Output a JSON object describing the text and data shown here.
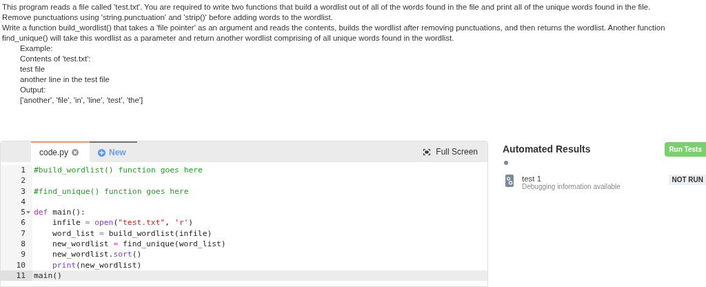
{
  "description": {
    "paragraphs": [
      "This program reads a file called 'test.txt'. You are required to write two functions that build a wordlist out of all of the words found in the file and print all of the unique words found in the file.",
      "Remove punctuations using 'string.punctuation' and 'strip()' before adding words to the wordlist.",
      "Write a function build_wordlist() that takes a 'file pointer' as an argument and reads the contents, builds the wordlist after removing punctuations, and then returns the wordlist. Another function",
      "find_unique() will take this wordlist as a parameter and return another wordlist comprising of all unique words found in the wordlist."
    ],
    "example": [
      "Example:",
      "Contents of 'test.txt':",
      "test file",
      "another line in the test file",
      "Output:",
      "['another', 'file', 'in', 'line', 'test', 'the']"
    ]
  },
  "editor": {
    "tabs": [
      {
        "label": "code.py",
        "kind": "file",
        "selected": true
      },
      {
        "label": "New",
        "kind": "new",
        "selected": false
      }
    ],
    "full_screen": "Full Screen",
    "lines": [
      {
        "number": "1",
        "fold": false,
        "active": false,
        "tokens": [
          {
            "kind": "comment",
            "t": "#build_wordlist() function goes here"
          }
        ]
      },
      {
        "number": "2",
        "fold": false,
        "active": false
      },
      {
        "number": "3",
        "fold": false,
        "active": false,
        "tokens": [
          {
            "kind": "comment",
            "t": "#find_unique() function goes here"
          }
        ]
      },
      {
        "number": "4",
        "fold": false,
        "active": false
      },
      {
        "number": "5",
        "fold": true,
        "active": false,
        "tokens": [
          {
            "kind": "keyword",
            "t": "def"
          },
          {
            "kind": "plain",
            "t": " main():"
          }
        ],
        "children": [
          {
            "number": "6",
            "fold": false,
            "active": false,
            "tokens": [
              {
                "kind": "plain",
                "t": "infile"
              },
              {
                "kind": "op",
                "t": " = "
              },
              {
                "kind": "builtin",
                "t": "open"
              },
              {
                "kind": "plain",
                "t": "("
              },
              {
                "kind": "string",
                "t": "\"test.txt\""
              },
              {
                "kind": "plain",
                "t": ", "
              },
              {
                "kind": "string",
                "t": "'r'"
              },
              {
                "kind": "plain",
                "t": ")"
              }
            ]
          },
          {
            "number": "7",
            "fold": false,
            "active": false,
            "tokens": [
              {
                "kind": "plain",
                "t": "word_list"
              },
              {
                "kind": "op",
                "t": " = "
              },
              {
                "kind": "plain",
                "t": "build_wordlist(infile)"
              }
            ]
          },
          {
            "number": "8",
            "fold": false,
            "active": false,
            "tokens": [
              {
                "kind": "plain",
                "t": "new_wordlist"
              },
              {
                "kind": "op",
                "t": " = "
              },
              {
                "kind": "plain",
                "t": "find_unique(word_list)"
              }
            ]
          },
          {
            "number": "9",
            "fold": false,
            "active": false,
            "tokens": [
              {
                "kind": "plain",
                "t": "new_wordlist."
              },
              {
                "kind": "builtin",
                "t": "sort"
              },
              {
                "kind": "plain",
                "t": "()"
              }
            ]
          },
          {
            "number": "10",
            "fold": false,
            "active": false,
            "tokens": [
              {
                "kind": "builtin",
                "t": "print"
              },
              {
                "kind": "plain",
                "t": "(new_wordlist)"
              }
            ]
          }
        ]
      },
      {
        "number": "11",
        "fold": false,
        "active": true,
        "tokens": [
          {
            "kind": "plain",
            "t": "main()"
          }
        ]
      }
    ]
  },
  "results": {
    "title": "Automated Results",
    "run_button": "Run Tests",
    "tests": [
      {
        "name": "test 1",
        "detail": "Debugging information available",
        "status": "NOT RUN"
      }
    ]
  }
}
